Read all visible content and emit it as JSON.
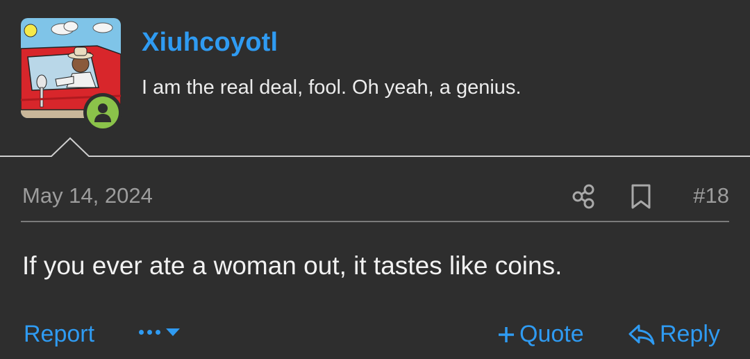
{
  "user": {
    "name": "Xiuhcoyotl",
    "title": "I am the real deal, fool. Oh yeah, a genius.",
    "avatar_icon": "cartoon-man-in-red-truck",
    "online_status_icon": "user-online-icon",
    "online_color": "#8bc34a"
  },
  "meta": {
    "date": "May 14, 2024",
    "share_icon": "share-icon",
    "bookmark_icon": "bookmark-icon",
    "post_number": "#18"
  },
  "post": {
    "body": "If you ever ate a woman out, it tastes like coins."
  },
  "actions": {
    "report_label": "Report",
    "more_icon": "ellipsis-dropdown-icon",
    "quote_label": "Quote",
    "quote_icon": "plus-icon",
    "reply_label": "Reply",
    "reply_icon": "reply-arrow-icon"
  },
  "colors": {
    "background": "#2e2e2e",
    "link": "#2f9bf2",
    "muted_text": "#9d9d9d",
    "text": "#f2f2f2"
  }
}
